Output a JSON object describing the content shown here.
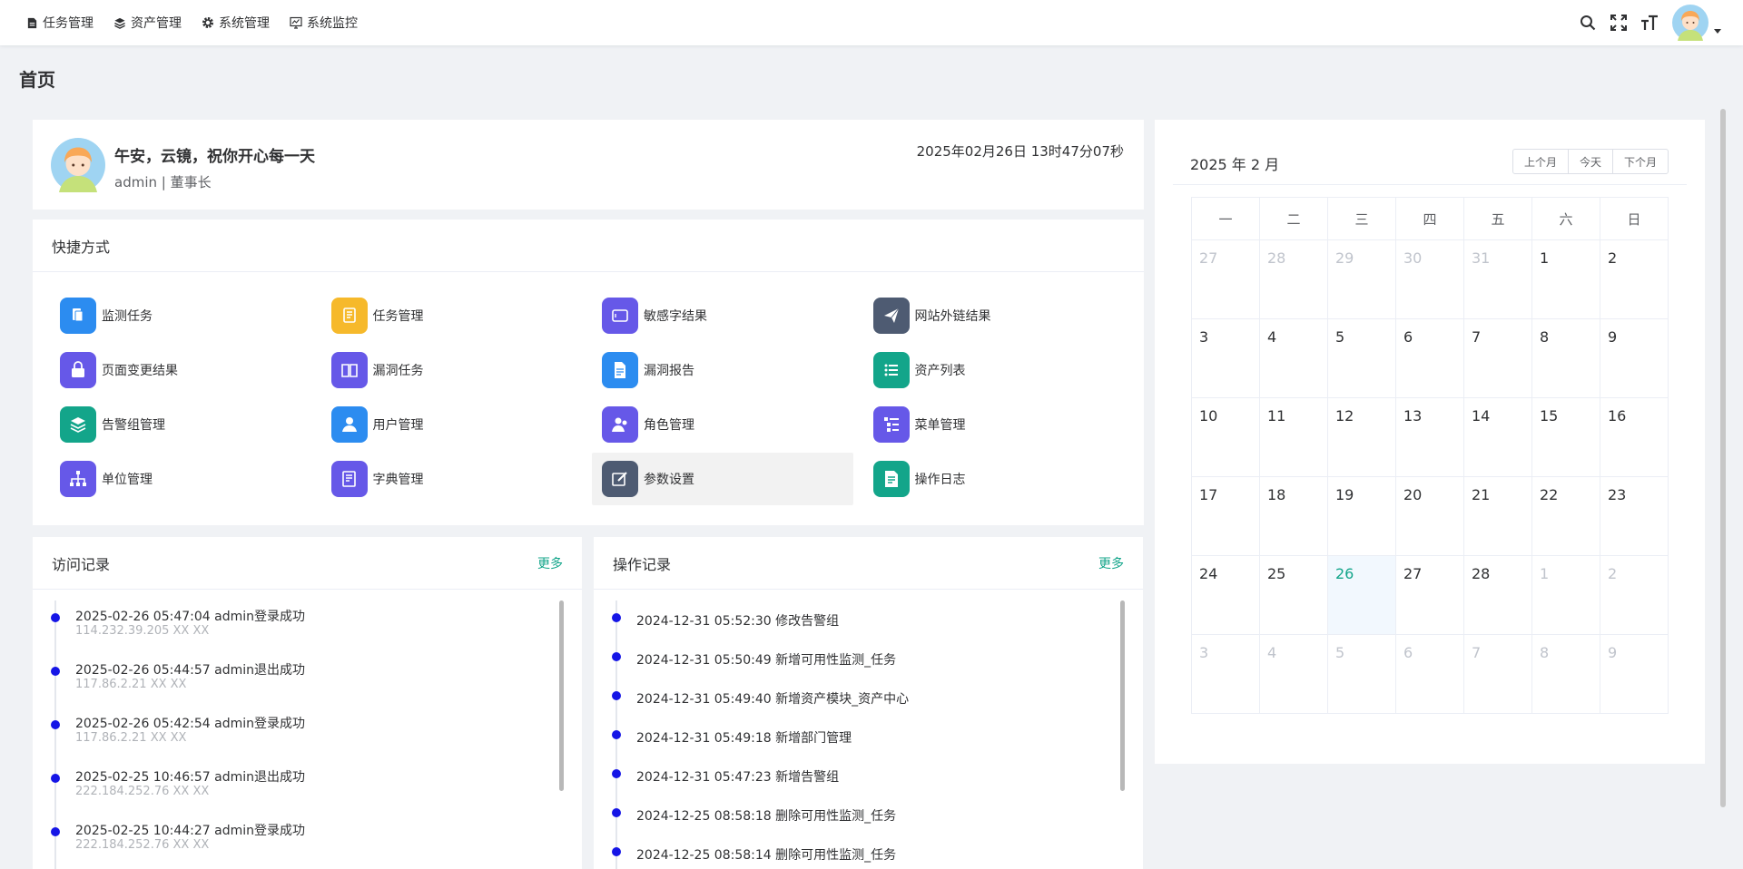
{
  "nav": {
    "menu": [
      {
        "label": "任务管理",
        "icon": "file-icon"
      },
      {
        "label": "资产管理",
        "icon": "layers-icon"
      },
      {
        "label": "系统管理",
        "icon": "gear-icon"
      },
      {
        "label": "系统监控",
        "icon": "monitor-icon"
      }
    ],
    "tools": [
      "search-icon",
      "fullscreen-icon",
      "font-size-icon"
    ]
  },
  "page": {
    "title": "首页"
  },
  "welcome": {
    "greeting": "午安，云镜，祝你开心每一天",
    "role": "admin | 董事长",
    "datetime": "2025年02月26日 13时47分07秒"
  },
  "shortcuts": {
    "title": "快捷方式",
    "items": [
      {
        "label": "监测任务",
        "color": "#2c8cf0",
        "icon": "clipboard-icon"
      },
      {
        "label": "任务管理",
        "color": "#f6b92b",
        "icon": "task-list-icon"
      },
      {
        "label": "敏感字结果",
        "color": "#6658e8",
        "icon": "tablet-icon"
      },
      {
        "label": "网站外链结果",
        "color": "#4e5b72",
        "icon": "paper-plane-icon"
      },
      {
        "label": "页面变更结果",
        "color": "#6658e8",
        "icon": "lock-icon"
      },
      {
        "label": "漏洞任务",
        "color": "#6658e8",
        "icon": "book-icon"
      },
      {
        "label": "漏洞报告",
        "color": "#2c8cf0",
        "icon": "document-icon"
      },
      {
        "label": "资产列表",
        "color": "#13a58a",
        "icon": "list-icon"
      },
      {
        "label": "告警组管理",
        "color": "#13a58a",
        "icon": "stack-icon"
      },
      {
        "label": "用户管理",
        "color": "#2c8cf0",
        "icon": "user-icon"
      },
      {
        "label": "角色管理",
        "color": "#6658e8",
        "icon": "users-icon"
      },
      {
        "label": "菜单管理",
        "color": "#6658e8",
        "icon": "menu-tree-icon"
      },
      {
        "label": "单位管理",
        "color": "#6658e8",
        "icon": "org-chart-icon"
      },
      {
        "label": "字典管理",
        "color": "#6658e8",
        "icon": "dictionary-icon"
      },
      {
        "label": "参数设置",
        "color": "#4e5b72",
        "icon": "edit-icon"
      },
      {
        "label": "操作日志",
        "color": "#13a58a",
        "icon": "log-icon"
      }
    ]
  },
  "visits": {
    "title": "访问记录",
    "more": "更多",
    "items": [
      {
        "main": "2025-02-26 05:47:04 admin登录成功",
        "sub": "114.232.39.205 XX XX"
      },
      {
        "main": "2025-02-26 05:44:57 admin退出成功",
        "sub": "117.86.2.21 XX XX"
      },
      {
        "main": "2025-02-26 05:42:54 admin登录成功",
        "sub": "117.86.2.21 XX XX"
      },
      {
        "main": "2025-02-25 10:46:57 admin退出成功",
        "sub": "222.184.252.76 XX XX"
      },
      {
        "main": "2025-02-25 10:44:27 admin登录成功",
        "sub": "222.184.252.76 XX XX"
      }
    ]
  },
  "operations": {
    "title": "操作记录",
    "more": "更多",
    "items": [
      "2024-12-31 05:52:30 修改告警组",
      "2024-12-31 05:50:49 新增可用性监测_任务",
      "2024-12-31 05:49:40 新增资产模块_资产中心",
      "2024-12-31 05:49:18 新增部门管理",
      "2024-12-31 05:47:23 新增告警组",
      "2024-12-25 08:58:18 删除可用性监测_任务",
      "2024-12-25 08:58:14 删除可用性监测_任务"
    ]
  },
  "calendar": {
    "title": "2025 年 2 月",
    "buttons": [
      "上个月",
      "今天",
      "下个月"
    ],
    "weekdays": [
      "一",
      "二",
      "三",
      "四",
      "五",
      "六",
      "日"
    ],
    "weeks": [
      [
        "27",
        "28",
        "29",
        "30",
        "31",
        "1",
        "2"
      ],
      [
        "3",
        "4",
        "5",
        "6",
        "7",
        "8",
        "9"
      ],
      [
        "10",
        "11",
        "12",
        "13",
        "14",
        "15",
        "16"
      ],
      [
        "17",
        "18",
        "19",
        "20",
        "21",
        "22",
        "23"
      ],
      [
        "24",
        "25",
        "26",
        "27",
        "28",
        "1",
        "2"
      ],
      [
        "3",
        "4",
        "5",
        "6",
        "7",
        "8",
        "9"
      ]
    ],
    "today": "26"
  },
  "colors": {
    "accent": "#13a58a",
    "timeline_dot": "#1515e6"
  }
}
